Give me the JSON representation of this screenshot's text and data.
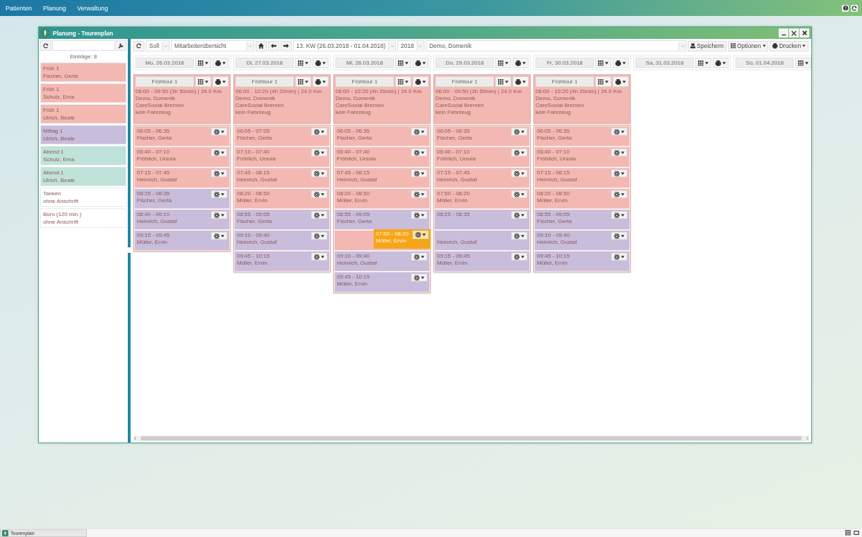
{
  "menu": [
    {
      "label": "Patienten"
    },
    {
      "label": "Planung"
    },
    {
      "label": "Verwaltung"
    }
  ],
  "window": {
    "title": "Planung - Tourenplan"
  },
  "sidebar": {
    "count": "Einträge: 8",
    "items": [
      {
        "shift": "Früh 1",
        "name": "Fischer, Gerta",
        "color": "#f4b8b2"
      },
      {
        "shift": "Früh 1",
        "name": "Schulz, Ema",
        "color": "#f4b8b2"
      },
      {
        "shift": "Früh 1",
        "name": "Ulrich, Beate",
        "color": "#f4b8b2"
      },
      {
        "shift": "Mittag 1",
        "name": "Ulrich, Beate",
        "color": "#c9bddc"
      },
      {
        "shift": "Abend 1",
        "name": "Schulz, Ema",
        "color": "#bfe3d9"
      },
      {
        "shift": "Abend 1",
        "name": "Ulrich, Beate",
        "color": "#bfe3d9"
      },
      {
        "shift": "Tanken",
        "name": "ohne Anschrift",
        "color": "#ffffff"
      },
      {
        "shift": "Büro (120 min.)",
        "name": "ohne Anschrift",
        "color": "#ffffff"
      }
    ]
  },
  "toolbar": {
    "mode": "Soll",
    "view": "Mitarbeiterübersicht",
    "week": "13. KW (26.03.2018 - 01.04.2018)",
    "year": "2018",
    "employee": "Demo, Domenik",
    "save": "Speichern",
    "options": "Optionen",
    "print": "Drucken"
  },
  "days": [
    {
      "date": "Mo, 26.03.2018",
      "tour": {
        "name": "Frühtour 1",
        "summary": "06:00 - 09:50 (3h 50min) | 24.0 Km",
        "person": "Demo, Domenik",
        "company": "CareSocial Bremen",
        "vehicle": "kein Fahrzeug",
        "visits": [
          {
            "kind": "visit",
            "time": "06:05 - 06:35",
            "name": "Fischer, Gerta",
            "color": "#f4b8b2"
          },
          {
            "kind": "visit",
            "time": "06:40 - 07:10",
            "name": "Fröhlich, Ursula",
            "color": "#f4b8b2"
          },
          {
            "kind": "visit",
            "time": "07:15 - 07:45",
            "name": "Heinrich, Gustaf",
            "color": "#f4b8b2"
          },
          {
            "kind": "visit",
            "time": "08:25 - 08:35",
            "name": "Fischer, Gerta",
            "color": "#c9bddc"
          },
          {
            "kind": "visit",
            "time": "08:40 - 09:10",
            "name": "Heinrich, Gustaf",
            "color": "#c9bddc"
          },
          {
            "kind": "visit",
            "time": "09:15 - 09:45",
            "name": "Müller, Ervin",
            "color": "#c9bddc"
          }
        ]
      }
    },
    {
      "date": "Di, 27.03.2018",
      "tour": {
        "name": "Frühtour 1",
        "summary": "06:00 - 10:20 (4h 20min) | 24.0 Km",
        "person": "Demo, Domenik",
        "company": "CareSocial Bremen",
        "vehicle": "kein Fahrzeug",
        "visits": [
          {
            "kind": "visit",
            "time": "06:05 - 07:05",
            "name": "Fischer, Gerta",
            "color": "#f4b8b2"
          },
          {
            "kind": "visit",
            "time": "07:10 - 07:40",
            "name": "Fröhlich, Ursula",
            "color": "#f4b8b2"
          },
          {
            "kind": "visit",
            "time": "07:45 - 08:15",
            "name": "Heinrich, Gustaf",
            "color": "#f4b8b2"
          },
          {
            "kind": "visit",
            "time": "08:20 - 08:50",
            "name": "Müller, Ervin",
            "color": "#f4b8b2"
          },
          {
            "kind": "visit",
            "time": "08:55 - 09:05",
            "name": "Fischer, Gerta",
            "color": "#c9bddc"
          },
          {
            "kind": "visit",
            "time": "09:10 - 09:40",
            "name": "Heinrich, Gustaf",
            "color": "#c9bddc"
          },
          {
            "kind": "visit",
            "time": "09:45 - 10:15",
            "name": "Müller, Ervin",
            "color": "#c9bddc"
          }
        ]
      }
    },
    {
      "date": "Mi, 28.03.2018",
      "tour": {
        "name": "Frühtour 1",
        "summary": "06:00 - 10:20 (4h 20min) | 24.0 Km",
        "person": "Demo, Domenik",
        "company": "CareSocial Bremen",
        "vehicle": "kein Fahrzeug",
        "visits": [
          {
            "kind": "visit",
            "time": "06:05 - 06:35",
            "name": "Fischer, Gerta",
            "color": "#f4b8b2"
          },
          {
            "kind": "visit",
            "time": "06:40 - 07:40",
            "name": "Fröhlich, Ursula",
            "color": "#f4b8b2"
          },
          {
            "kind": "visit",
            "time": "07:45 - 08:15",
            "name": "Heinrich, Gustaf",
            "color": "#f4b8b2"
          },
          {
            "kind": "visit",
            "time": "08:20 - 08:50",
            "name": "Müller, Ervin",
            "color": "#f4b8b2"
          },
          {
            "kind": "visit",
            "time": "08:55 - 09:05",
            "name": "Fischer, Gerta",
            "color": "#c9bddc"
          },
          {
            "kind": "gap",
            "color": "#f4b8b2",
            "dragged": {
              "time": "07:50 - 08:20",
              "name": "Müller, Ervin"
            }
          },
          {
            "kind": "visit",
            "time": "09:10 - 09:40",
            "name": "Heinrich, Gustaf",
            "color": "#c9bddc"
          },
          {
            "kind": "visit",
            "time": "09:45 - 10:15",
            "name": "Müller, Ervin",
            "color": "#c9bddc"
          }
        ]
      }
    },
    {
      "date": "Do, 29.03.2018",
      "tour": {
        "name": "Frühtour 1",
        "summary": "06:00 - 09:50 (3h 50min) | 24.0 Km",
        "person": "Demo, Domenik",
        "company": "CareSocial Bremen",
        "vehicle": "kein Fahrzeug",
        "visits": [
          {
            "kind": "visit",
            "time": "06:05 - 06:35",
            "name": "Fischer, Gerta",
            "color": "#f4b8b2"
          },
          {
            "kind": "visit",
            "time": "06:40 - 07:10",
            "name": "Fröhlich, Ursula",
            "color": "#f4b8b2"
          },
          {
            "kind": "visit",
            "time": "07:15 - 07:45",
            "name": "Heinrich, Gustaf",
            "color": "#f4b8b2"
          },
          {
            "kind": "visit",
            "time": "07:50 - 08:20",
            "name": "Müller, Ervin",
            "color": "#f4b8b2"
          },
          {
            "kind": "visit",
            "time": "08:25 - 08:35",
            "color": "#c9bddc"
          },
          {
            "kind": "visit",
            "name": "Heinrich, Gustaf",
            "color": "#c9bddc"
          },
          {
            "kind": "visit",
            "time": "09:15 - 09:45",
            "name": "Müller, Ervin",
            "color": "#c9bddc"
          }
        ]
      }
    },
    {
      "date": "Fr, 30.03.2018",
      "tour": {
        "name": "Frühtour 1",
        "summary": "06:00 - 10:20 (4h 20min) | 24.0 Km",
        "person": "Demo, Domenik",
        "company": "CareSocial Bremen",
        "vehicle": "kein Fahrzeug",
        "visits": [
          {
            "kind": "visit",
            "time": "06:05 - 06:35",
            "name": "Fischer, Gerta",
            "color": "#f4b8b2"
          },
          {
            "kind": "visit",
            "time": "06:40 - 07:10",
            "name": "Fröhlich, Ursula",
            "color": "#f4b8b2"
          },
          {
            "kind": "visit",
            "time": "07:15 - 08:15",
            "name": "Heinrich, Gustaf",
            "color": "#f4b8b2"
          },
          {
            "kind": "visit",
            "time": "08:20 - 08:50",
            "name": "Müller, Ervin",
            "color": "#f4b8b2"
          },
          {
            "kind": "visit",
            "time": "08:55 - 09:05",
            "name": "Fischer, Gerta",
            "color": "#c9bddc"
          },
          {
            "kind": "visit",
            "time": "09:10 - 09:40",
            "name": "Heinrich, Gustaf",
            "color": "#c9bddc"
          },
          {
            "kind": "visit",
            "time": "09:45 - 10:15",
            "name": "Müller, Ervin",
            "color": "#c9bddc"
          }
        ]
      }
    },
    {
      "date": "Sa, 31.03.2018"
    },
    {
      "date": "So, 01.04.2018",
      "menus": [
        {
          "kind": "grid"
        }
      ]
    }
  ],
  "taskbar": {
    "tasks": [
      {
        "label": "Tourenplan"
      }
    ]
  }
}
